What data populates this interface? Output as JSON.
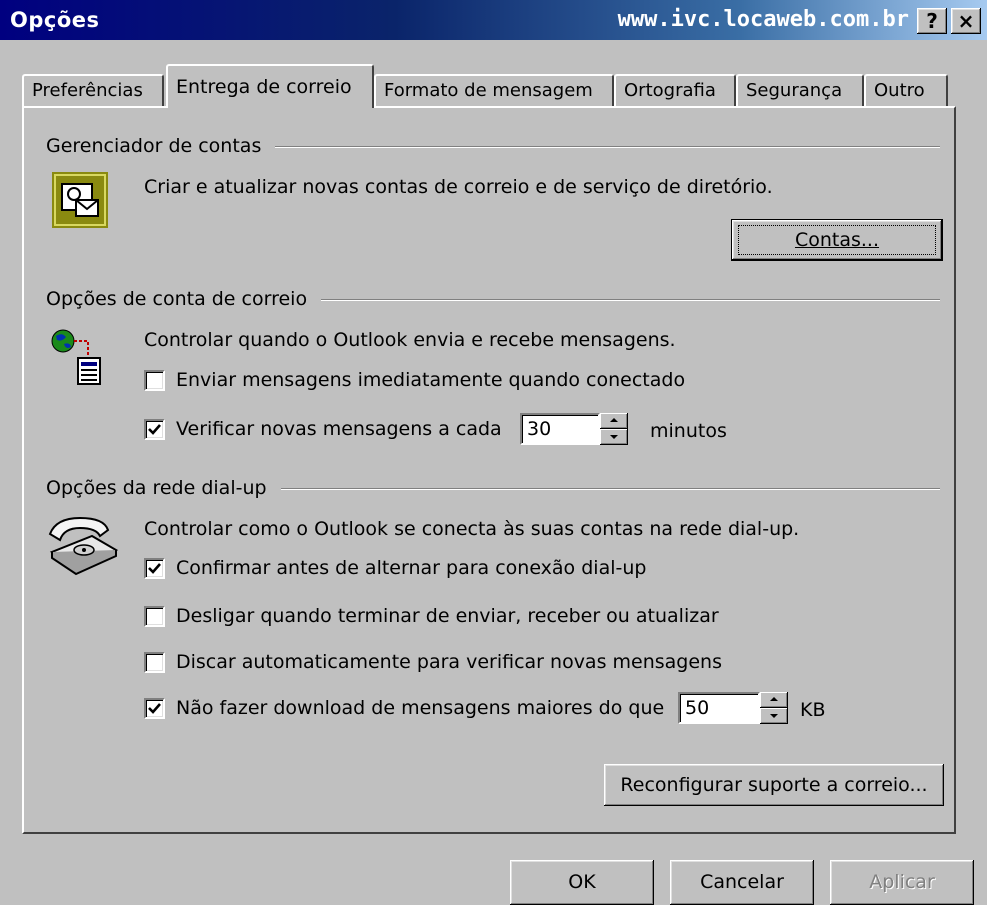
{
  "window": {
    "title": "Opções",
    "url": "www.ivc.locaweb.com.br",
    "help_label": "?",
    "close_label": "×"
  },
  "tabs": [
    {
      "label": "Preferências",
      "active": false
    },
    {
      "label": "Entrega de correio",
      "active": true
    },
    {
      "label": "Formato de mensagem",
      "active": false
    },
    {
      "label": "Ortografia",
      "active": false
    },
    {
      "label": "Segurança",
      "active": false
    },
    {
      "label": "Outro",
      "active": false
    }
  ],
  "accounts": {
    "title": "Gerenciador de contas",
    "description": "Criar e atualizar novas contas de correio e de serviço de diretório.",
    "button_label": "Contas..."
  },
  "mail_options": {
    "title": "Opções de conta de correio",
    "description": "Controlar quando o Outlook envia e recebe mensagens.",
    "send_immediately": {
      "label": "Enviar mensagens imediatamente quando conectado",
      "checked": false
    },
    "check_every": {
      "label": "Verificar novas mensagens a cada",
      "checked": true,
      "value": "30",
      "unit": "minutos"
    }
  },
  "dialup": {
    "title": "Opções da rede dial-up",
    "description": "Controlar como o Outlook se conecta às suas contas na rede dial-up.",
    "confirm": {
      "label": "Confirmar antes de alternar para conexão dial-up",
      "checked": true
    },
    "hangup": {
      "label": "Desligar quando terminar de enviar, receber ou atualizar",
      "checked": false
    },
    "autodial": {
      "label": "Discar automaticamente para verificar novas mensagens",
      "checked": false
    },
    "no_download": {
      "label": "Não fazer download de mensagens maiores do que",
      "checked": true,
      "value": "50",
      "unit": "KB"
    }
  },
  "reconfigure_label": "Reconfigurar suporte a correio...",
  "footer": {
    "ok": "OK",
    "cancel": "Cancelar",
    "apply": "Aplicar"
  },
  "colors": {
    "titlebar_start": "#000080",
    "titlebar_end": "#a6caf0",
    "face": "#c0c0c0",
    "account_icon": "#8a8a10"
  }
}
